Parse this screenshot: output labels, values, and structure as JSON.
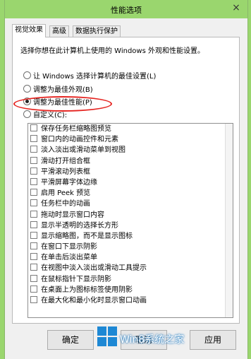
{
  "window": {
    "title": "性能选项",
    "close_glyph": "×"
  },
  "tabs": [
    {
      "label": "视觉效果",
      "active": true
    },
    {
      "label": "高级",
      "active": false
    },
    {
      "label": "数据执行保护",
      "active": false
    }
  ],
  "description": "选择你想在此计算机上使用的 Windows 外观和性能设置。",
  "options": [
    {
      "label": "让 Windows 选择计算机的最佳设置(L)",
      "checked": false
    },
    {
      "label": "调整为最佳外观(B)",
      "checked": false
    },
    {
      "label": "调整为最佳性能(P)",
      "checked": true
    },
    {
      "label": "自定义(C):",
      "checked": false
    }
  ],
  "effects": [
    "保存任务栏缩略图预览",
    "窗口内的动画控件和元素",
    "淡入淡出或滑动菜单到视图",
    "滑动打开组合框",
    "平滑滚动列表框",
    "平滑屏幕字体边缘",
    "启用 Peek 预览",
    "任务栏中的动画",
    "拖动时显示窗口内容",
    "显示半透明的选择长方形",
    "显示缩略图，而不是显示图标",
    "在窗口下显示阴影",
    "在单击后淡出菜单",
    "在视图中淡入淡出或滑动工具提示",
    "在鼠标指针下显示阴影",
    "在桌面上为图标标签使用阴影",
    "在最大化和最小化时显示窗口动画"
  ],
  "buttons": {
    "ok": "确定",
    "cancel": "取消",
    "apply": "应用"
  },
  "watermark": {
    "text": "Win8系统之家",
    "accent": "#1e88d4"
  },
  "highlight_color": "#e5231f"
}
